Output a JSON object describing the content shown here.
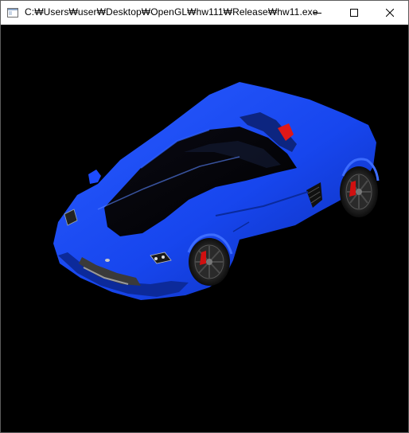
{
  "window": {
    "title": "C:₩Users₩user₩Desktop₩OpenGL₩hw111₩Release₩hw11.exe",
    "controls": {
      "minimize_icon": "minimize-icon",
      "maximize_icon": "maximize-icon",
      "close_icon": "close-icon"
    }
  },
  "viewport": {
    "background": "#000000",
    "model": "blue-sports-car",
    "body_color": "#1a4cff",
    "wheel_accent": "#d01010"
  }
}
